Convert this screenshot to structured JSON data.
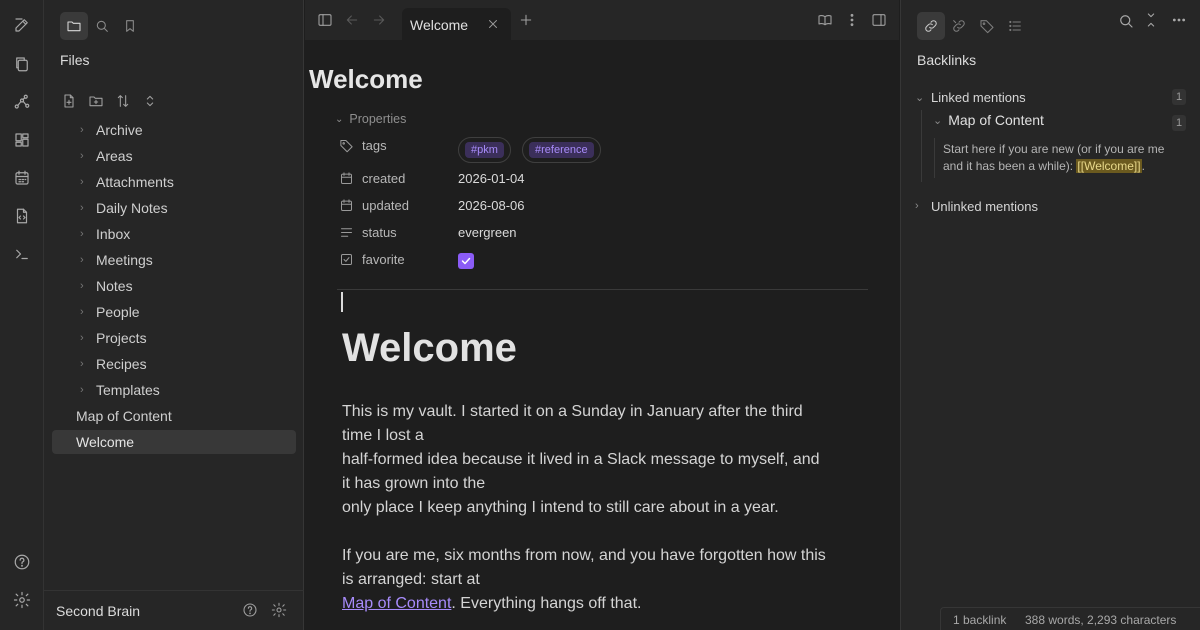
{
  "left_sidebar": {
    "title": "Files",
    "tree": [
      {
        "label": "Archive",
        "type": "folder"
      },
      {
        "label": "Areas",
        "type": "folder"
      },
      {
        "label": "Attachments",
        "type": "folder"
      },
      {
        "label": "Daily Notes",
        "type": "folder"
      },
      {
        "label": "Inbox",
        "type": "folder"
      },
      {
        "label": "Meetings",
        "type": "folder"
      },
      {
        "label": "Notes",
        "type": "folder"
      },
      {
        "label": "People",
        "type": "folder"
      },
      {
        "label": "Projects",
        "type": "folder"
      },
      {
        "label": "Recipes",
        "type": "folder"
      },
      {
        "label": "Templates",
        "type": "folder"
      },
      {
        "label": "Map of Content",
        "type": "file"
      },
      {
        "label": "Welcome",
        "type": "file",
        "active": true
      }
    ],
    "vault_name": "Second Brain"
  },
  "tabs": [
    {
      "label": "Welcome",
      "active": true
    }
  ],
  "note": {
    "inline_title": "Welcome",
    "properties_label": "Properties",
    "properties": {
      "tags_key": "tags",
      "tags": [
        "#pkm",
        "#reference"
      ],
      "created_key": "created",
      "created": "2026-01-04",
      "updated_key": "updated",
      "updated": "2026-08-06",
      "status_key": "status",
      "status": "evergreen",
      "favorite_key": "favorite",
      "favorite": true
    },
    "heading": "Welcome",
    "para1_line1": "This is my vault. I started it on a Sunday in January after the third",
    "para1_line2": "time I lost a",
    "para1_line3": "half-formed idea because it lived in a Slack message to myself, and",
    "para1_line4": "it has grown into the",
    "para1_line5": "only place I keep anything I intend to still care about in a year.",
    "para2_line1": "If you are me, six months from now, and you have forgotten how this",
    "para2_line2": "is arranged: start at",
    "para2_link": "Map of Content",
    "para2_tail": ". Everything hangs off that."
  },
  "right_sidebar": {
    "title": "Backlinks",
    "linked_mentions": "Linked mentions",
    "linked_count": "1",
    "source_note": "Map of Content",
    "source_count": "1",
    "snippet_pre": "Start here if you are new (or if you are me and it has been a while): ",
    "snippet_link": "[[Welcome]]",
    "snippet_post": ".",
    "unlinked_mentions": "Unlinked mentions"
  },
  "status_bar": {
    "backlinks": "1 backlink",
    "word_count": "388 words, 2,293 characters"
  },
  "colors": {
    "accent": "#8b5cf6",
    "link": "#a78bfa",
    "highlight": "#6b5a1f"
  }
}
